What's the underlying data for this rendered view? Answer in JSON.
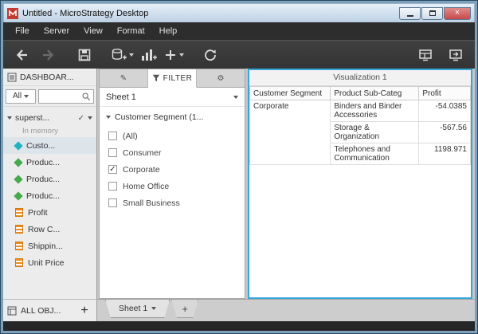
{
  "window": {
    "title": "Untitled - MicroStrategy Desktop",
    "close_glyph": "×"
  },
  "menu": {
    "items": [
      "File",
      "Server",
      "View",
      "Format",
      "Help"
    ]
  },
  "toolbar": {
    "icons": [
      "back",
      "forward",
      "save",
      "add-data",
      "add-visualization",
      "add",
      "refresh",
      "layout",
      "presentation"
    ]
  },
  "sidebar": {
    "header_label": "DASHBOAR...",
    "filter_value": "All",
    "dataset_name": "superst...",
    "dataset_status": "In memory",
    "items": [
      {
        "label": "Custo...",
        "type": "attribute-teal",
        "selected": true
      },
      {
        "label": "Produc...",
        "type": "attribute-green",
        "selected": false
      },
      {
        "label": "Produc...",
        "type": "attribute-green",
        "selected": false
      },
      {
        "label": "Produc...",
        "type": "attribute-green",
        "selected": false
      },
      {
        "label": "Profit",
        "type": "metric",
        "selected": false
      },
      {
        "label": "Row C...",
        "type": "metric",
        "selected": false
      },
      {
        "label": "Shippin...",
        "type": "metric",
        "selected": false
      },
      {
        "label": "Unit Price",
        "type": "metric",
        "selected": false
      }
    ],
    "footer_label": "ALL OBJ...",
    "footer_add": "+"
  },
  "filter_panel": {
    "tab_label": "FILTER",
    "sheet_label": "Sheet 1",
    "group_label": "Customer Segment (1...",
    "options": [
      {
        "label": "(All)",
        "checked": false
      },
      {
        "label": "Consumer",
        "checked": false
      },
      {
        "label": "Corporate",
        "checked": true
      },
      {
        "label": "Home Office",
        "checked": false
      },
      {
        "label": "Small Business",
        "checked": false
      }
    ]
  },
  "visualization": {
    "title": "Visualization 1",
    "columns": [
      "Customer Segment",
      "Product Sub-Categ",
      "Profit"
    ],
    "rows": [
      {
        "segment": "Corporate",
        "subcategory": "Binders and Binder Accessories",
        "profit": "-54.0385"
      },
      {
        "segment": "",
        "subcategory": "Storage & Organization",
        "profit": "-567.56"
      },
      {
        "segment": "",
        "subcategory": "Telephones and Communication",
        "profit": "1198.971"
      }
    ]
  },
  "bottom": {
    "sheet_tab": "Sheet 1",
    "add_tab": "+"
  },
  "colors": {
    "accent_blue": "#35a7dc",
    "metric_orange": "#f08c1e",
    "attribute_teal": "#1fb3bd",
    "attribute_green": "#45a94d",
    "close_red": "#c64a4d"
  }
}
